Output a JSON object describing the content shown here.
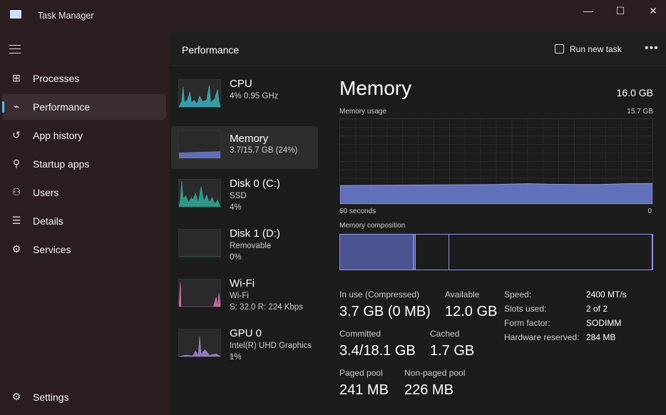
{
  "window": {
    "title": "Task Manager",
    "minimize": "—",
    "maximize": "☐",
    "close": "✕"
  },
  "sidebar": {
    "items": [
      {
        "label": "Processes",
        "icon": "processes-icon",
        "glyph": "⊞"
      },
      {
        "label": "Performance",
        "icon": "performance-icon",
        "glyph": "⌁",
        "active": true
      },
      {
        "label": "App history",
        "icon": "history-icon",
        "glyph": "↺"
      },
      {
        "label": "Startup apps",
        "icon": "startup-icon",
        "glyph": "⚲"
      },
      {
        "label": "Users",
        "icon": "users-icon",
        "glyph": "⚇"
      },
      {
        "label": "Details",
        "icon": "details-icon",
        "glyph": "☰"
      },
      {
        "label": "Services",
        "icon": "services-icon",
        "glyph": "⚙"
      }
    ],
    "settings": {
      "label": "Settings",
      "glyph": "⚙"
    }
  },
  "header": {
    "title": "Performance",
    "run_new_task": "Run new task",
    "more": "•••"
  },
  "devices": [
    {
      "name": "CPU",
      "sub1": "4%  0.95 GHz",
      "sub2": "",
      "color": "#3fb8c8"
    },
    {
      "name": "Memory",
      "sub1": "3.7/15.7 GB (24%)",
      "sub2": "",
      "color": "#6f7fd6",
      "active": true
    },
    {
      "name": "Disk 0 (C:)",
      "sub1": "SSD",
      "sub2": "4%",
      "color": "#2fb3a0"
    },
    {
      "name": "Disk 1 (D:)",
      "sub1": "Removable",
      "sub2": "0%",
      "color": "#2fb3a0"
    },
    {
      "name": "Wi-Fi",
      "sub1": "Wi-Fi",
      "sub2": "S: 32.0  R: 224 Kbps",
      "color": "#e07ac0"
    },
    {
      "name": "GPU 0",
      "sub1": "Intel(R) UHD Graphics ...",
      "sub2": "1%",
      "color": "#a98be0"
    }
  ],
  "memory": {
    "title": "Memory",
    "total": "16.0 GB",
    "usage_label": "Memory usage",
    "usage_max": "15.7 GB",
    "x_left": "60 seconds",
    "x_right": "0",
    "composition_label": "Memory composition",
    "stats": {
      "in_use_label": "In use (Compressed)",
      "in_use": "3.7 GB (0 MB)",
      "available_label": "Available",
      "available": "12.0 GB",
      "committed_label": "Committed",
      "committed": "3.4/18.1 GB",
      "cached_label": "Cached",
      "cached": "1.7 GB",
      "paged_label": "Paged pool",
      "paged": "241 MB",
      "nonpaged_label": "Non-paged pool",
      "nonpaged": "226 MB"
    },
    "specs": [
      {
        "k": "Speed:",
        "v": "2400 MT/s"
      },
      {
        "k": "Slots used:",
        "v": "2 of 2"
      },
      {
        "k": "Form factor:",
        "v": "SODIMM"
      },
      {
        "k": "Hardware reserved:",
        "v": "284 MB"
      }
    ],
    "accent": "#6f7fd6"
  },
  "chart_data": {
    "type": "area",
    "xlabel": "60 seconds",
    "ylim": [
      0,
      15.7
    ],
    "xlim": [
      60,
      0
    ],
    "x": [
      60,
      52,
      45,
      38,
      30,
      24,
      20,
      14,
      10,
      5,
      0
    ],
    "values": [
      3.4,
      3.45,
      3.5,
      3.55,
      3.6,
      3.75,
      3.65,
      3.6,
      3.6,
      3.75,
      3.8
    ],
    "composition": {
      "in_use_gb": 3.7,
      "modified_gb": 0.1,
      "standby_gb": 1.7,
      "free_gb": 10.2
    }
  }
}
